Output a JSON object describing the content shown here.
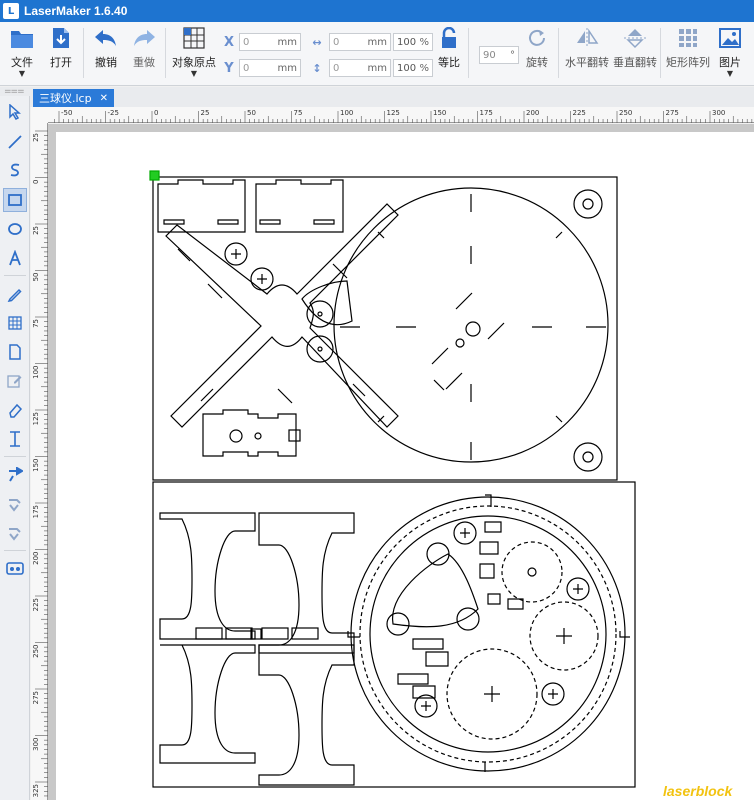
{
  "app": {
    "title": "LaserMaker 1.6.40"
  },
  "toolbar": {
    "file_label": "文件",
    "open_label": "打开",
    "undo_label": "撤销",
    "redo_label": "重做",
    "origin_label": "对象原点",
    "x_label": "X",
    "y_label": "Y",
    "x_value": "0",
    "y_value": "0",
    "width_value": "0",
    "height_value": "0",
    "unit_mm": "mm",
    "scale_w": "100",
    "scale_h": "100",
    "unit_pct": "%",
    "equal_ratio_label": "等比",
    "rotation_value": "90",
    "rotation_unit": "°",
    "rotate_label": "旋转",
    "flip_h_label": "水平翻转",
    "flip_v_label": "垂直翻转",
    "array_label": "矩形阵列",
    "image_label": "图片"
  },
  "tabs": [
    {
      "label": "三球仪.lcp",
      "close": "✕"
    }
  ],
  "ruler": {
    "h_ticks": [
      "-50",
      "-25",
      "0",
      "25",
      "50",
      "75",
      "100",
      "125",
      "150",
      "175",
      "200",
      "225",
      "250",
      "275",
      "300"
    ],
    "v_ticks": [
      "25",
      "0",
      "25",
      "50",
      "75",
      "100",
      "125",
      "150",
      "175",
      "200",
      "225",
      "250",
      "275",
      "300",
      "325"
    ]
  },
  "watermark": "laserblock",
  "colors": {
    "titlebar": "#1e74d0",
    "tab_active": "#2b7ad8",
    "accent_icon": "#2f6fc9",
    "canvas_bg": "#c8c8c8"
  }
}
